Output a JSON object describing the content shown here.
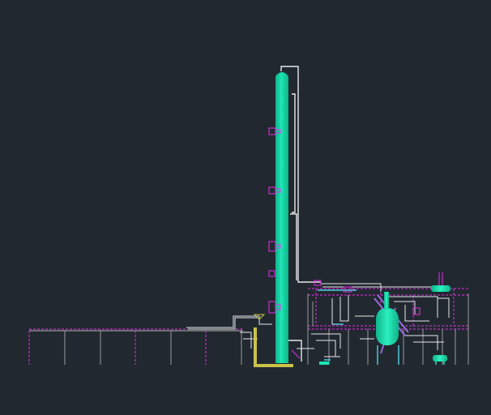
{
  "viewport": {
    "background": "#212830",
    "colors": {
      "equipment": "#19e6b0",
      "equipment_shade": "#0fb489",
      "steel_magenta": "#e62ee6",
      "steel_gray": "#9a9a9a",
      "pipe_white": "#e8e8e8",
      "pipe_cyan": "#4fd4e8",
      "support_yellow": "#c9c24a",
      "pipe_lilac": "#9a6bd8"
    },
    "icons": [
      "distillation-column",
      "reflux-drum",
      "reboiler-vessel",
      "pipe-rack",
      "column-nozzle"
    ]
  }
}
